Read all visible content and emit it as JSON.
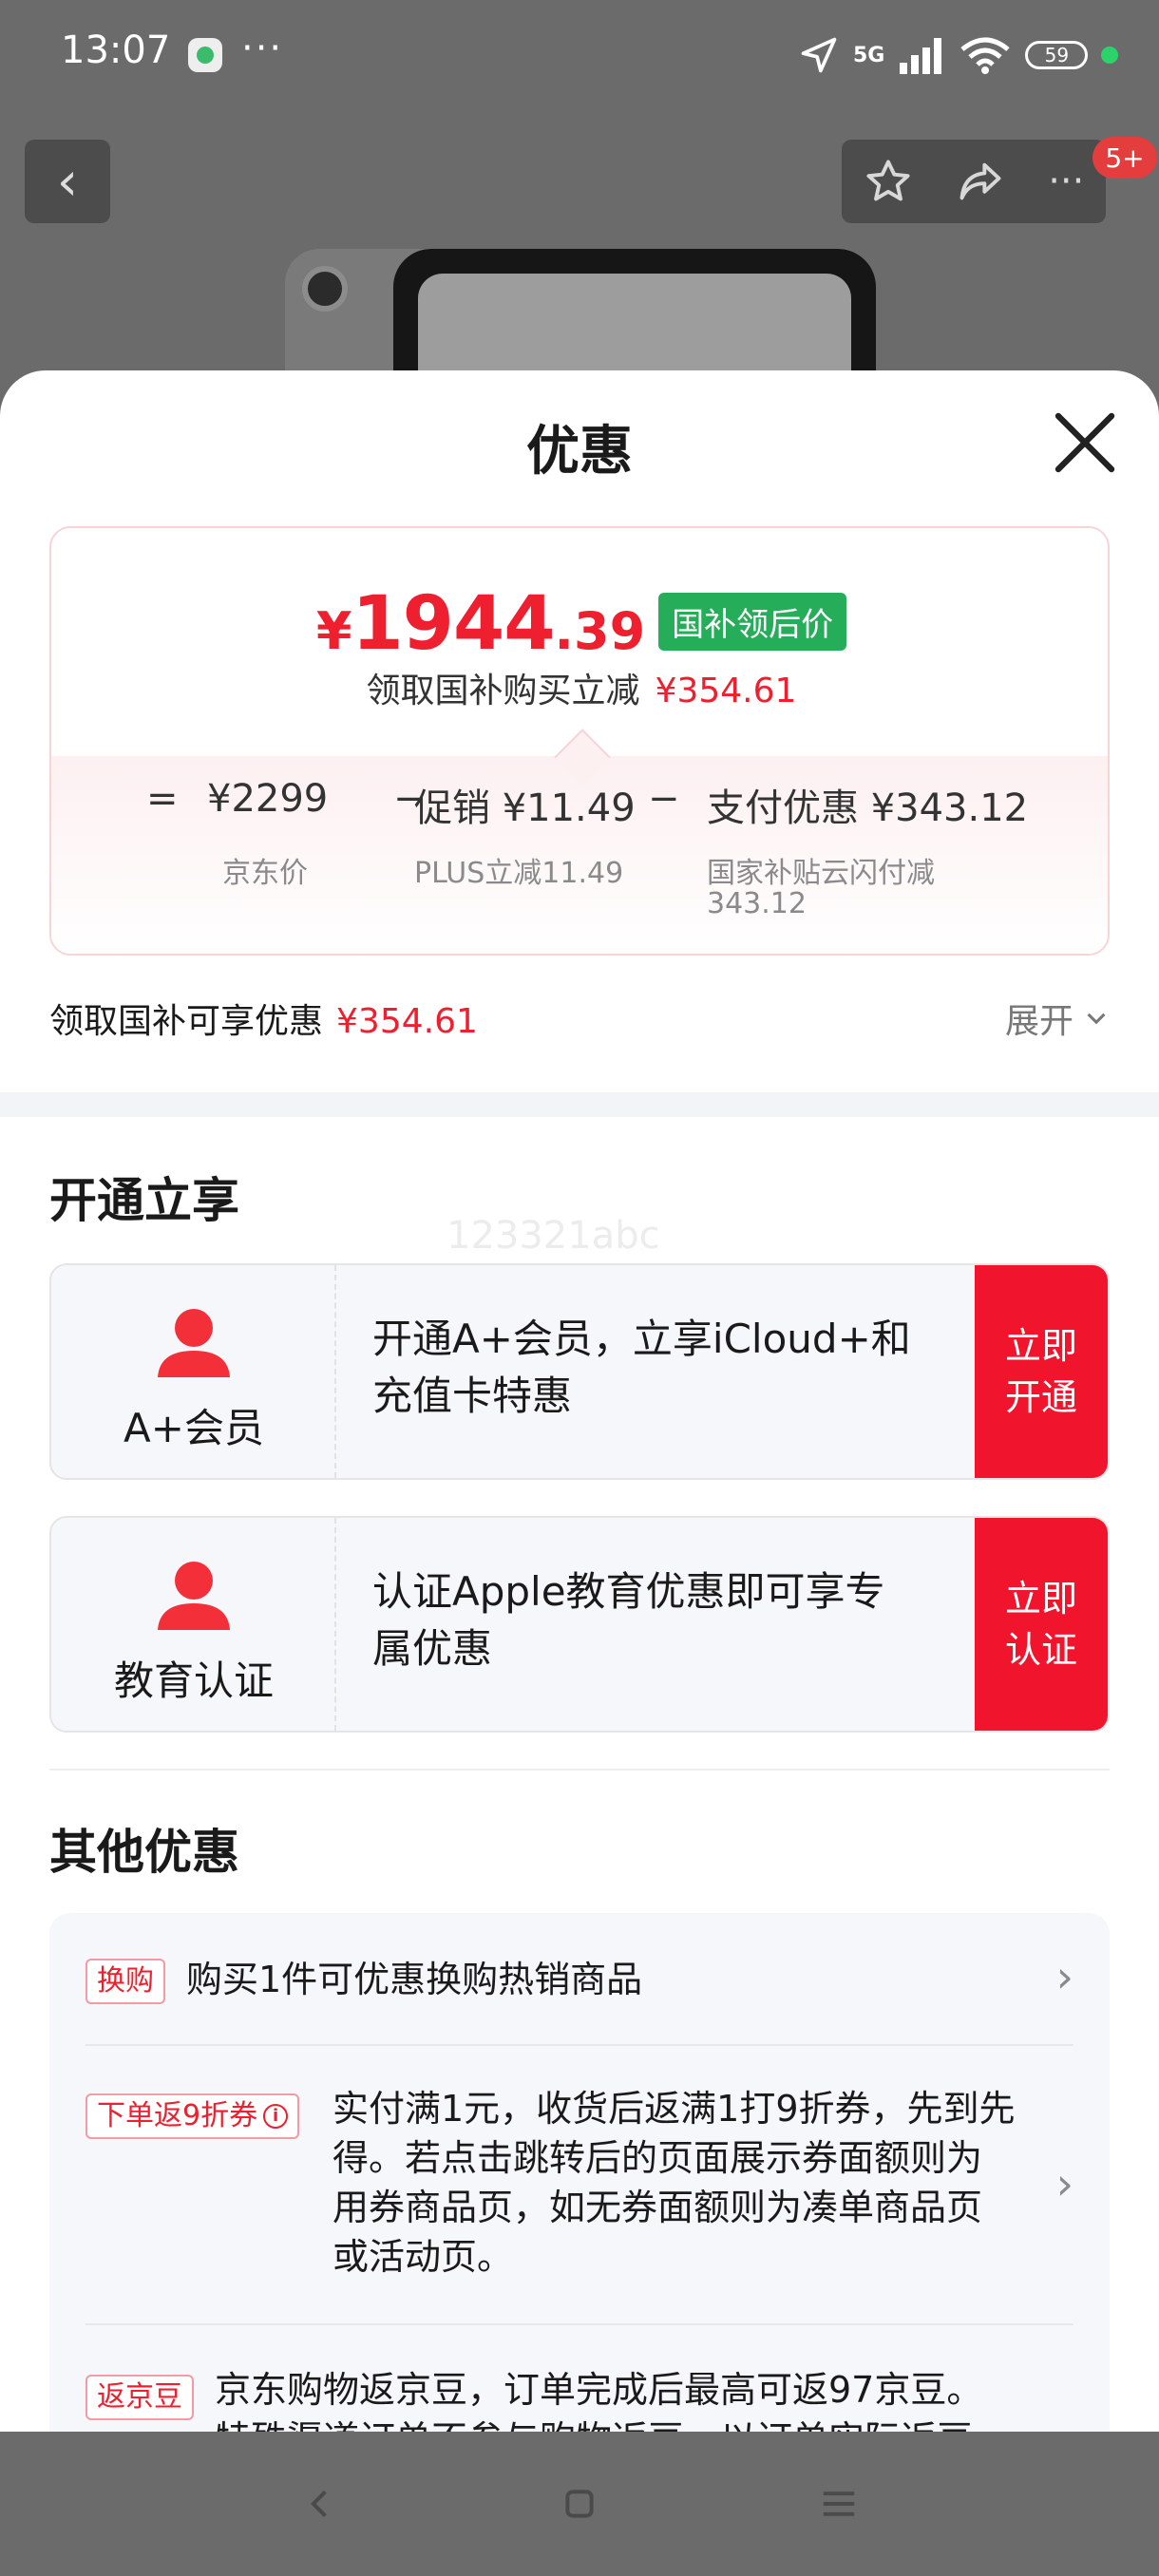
{
  "status_bar": {
    "time": "13:07",
    "more": "···",
    "network": "5G",
    "battery": "59"
  },
  "nav": {
    "more": "···",
    "badge": "5+"
  },
  "sheet": {
    "title": "优惠",
    "price": {
      "symbol": "¥",
      "integer": "1944",
      "decimal": ".39",
      "tag": "国补领后价",
      "sub_text": "领取国补购买立减",
      "sub_amount": "¥354.61"
    },
    "formula": {
      "eq": "=",
      "jd_price": "¥2299",
      "jd_label": "京东价",
      "minus1": "−",
      "promo": "促销 ¥11.49",
      "promo_label": "PLUS立减11.49",
      "minus2": "−",
      "pay": "支付优惠 ¥343.12",
      "pay_label_1": "国家补贴云闪付减",
      "pay_label_2": "343.12"
    },
    "summary": {
      "label": "领取国补可享优惠",
      "amount": "¥354.61",
      "expand": "展开"
    },
    "open_section": {
      "title": "开通立享",
      "watermark": "123321abc",
      "cards": [
        {
          "name": "A+会员",
          "desc_1": "开通A+会员，立享iCloud+和",
          "desc_2": "充值卡特惠",
          "btn_1": "立即",
          "btn_2": "开通"
        },
        {
          "name": "教育认证",
          "desc_1": "认证Apple教育优惠即可享专",
          "desc_2": "属优惠",
          "btn_1": "立即",
          "btn_2": "认证"
        }
      ]
    },
    "other_section": {
      "title": "其他优惠",
      "items": [
        {
          "tag": "换购",
          "text": "购买1件可优惠换购热销商品"
        },
        {
          "tag": "下单返9折券",
          "lines": [
            "实付满1元，收货后返满1打9折券，先到先",
            "得。若点击跳转后的页面展示券面额则为",
            "用券商品页，如无券面额则为凑单商品页",
            "或活动页。"
          ]
        },
        {
          "tag": "返京豆",
          "lines": [
            "京东购物返京豆，订单完成后最高可返97京豆。",
            "特殊渠道订单不参与购物返豆，以订单实际返豆"
          ]
        }
      ]
    }
  }
}
